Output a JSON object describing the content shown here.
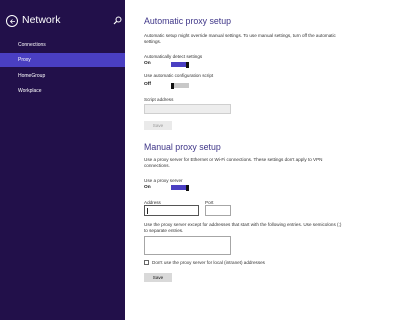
{
  "nav": {
    "title": "Network",
    "items": [
      {
        "label": "Connections",
        "selected": false
      },
      {
        "label": "Proxy",
        "selected": true
      },
      {
        "label": "HomeGroup",
        "selected": false
      },
      {
        "label": "Workplace",
        "selected": false
      }
    ]
  },
  "auto": {
    "heading": "Automatic proxy setup",
    "description": "Automatic setup might override manual settings. To use manual settings, turn off the automatic settings.",
    "detect_label": "Automatically detect settings",
    "detect_state": "On",
    "script_label": "Use automatic configuration script",
    "script_state": "Off",
    "address_label": "Script address",
    "address_value": "",
    "save_label": "Save"
  },
  "manual": {
    "heading": "Manual proxy setup",
    "description": "Use a proxy server for Ethernet or Wi-Fi connections. These settings don't apply to VPN connections.",
    "use_proxy_label": "Use a proxy server",
    "use_proxy_state": "On",
    "address_label": "Address",
    "address_value": "",
    "port_label": "Port",
    "port_value": "",
    "exceptions_label": "Use the proxy server except for addresses that start with the following entries. Use semicolons (;) to separate entries.",
    "exceptions_value": "",
    "local_label": "Don't use the proxy server for local (intranet) addresses",
    "save_label": "Save"
  },
  "colors": {
    "sidebar": "#22104a",
    "accent": "#4a3fc2",
    "heading": "#3f3688"
  }
}
